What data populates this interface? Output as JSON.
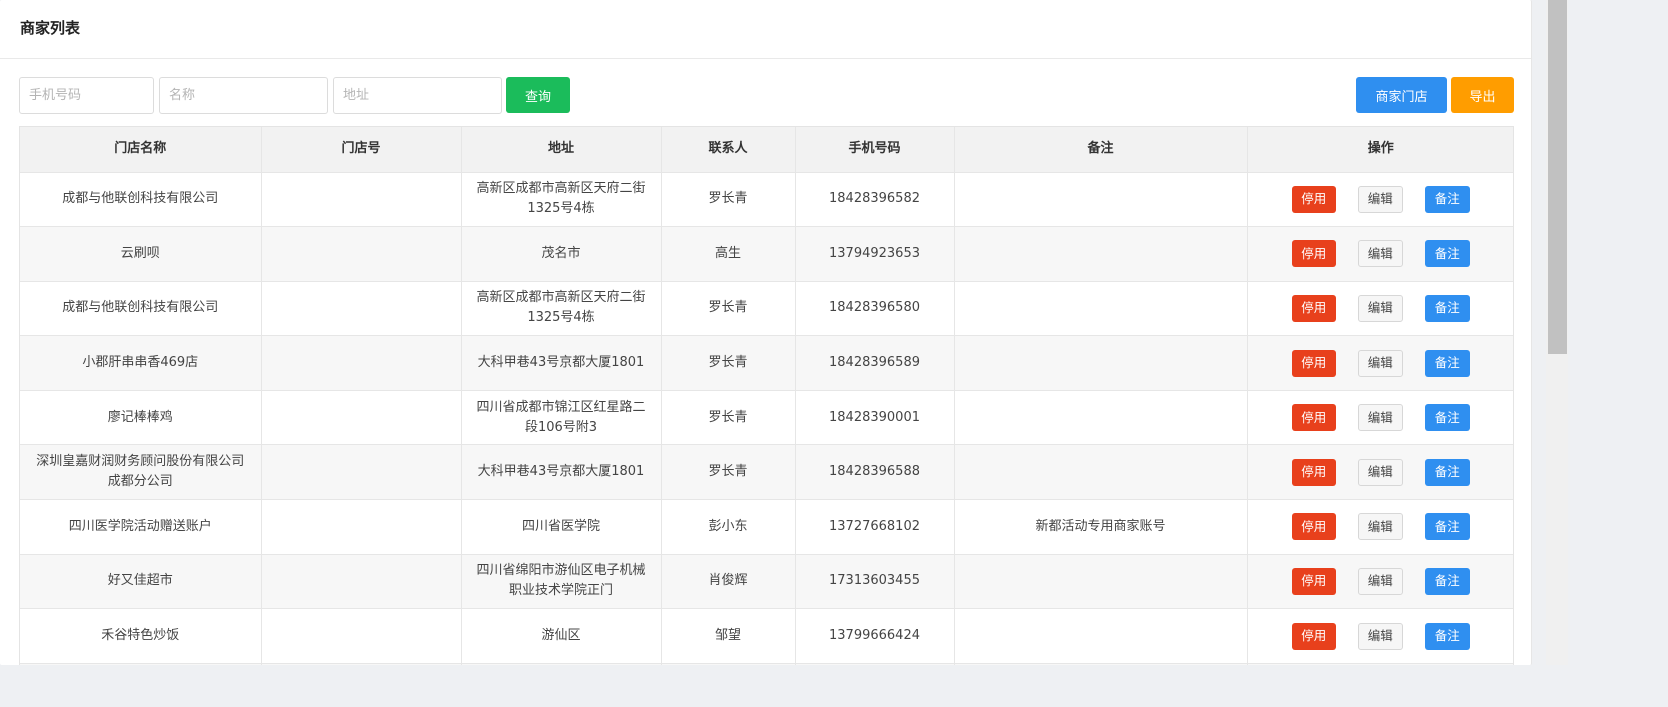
{
  "title": "商家列表",
  "search": {
    "phone_placeholder": "手机号码",
    "name_placeholder": "名称",
    "address_placeholder": "地址",
    "query_label": "查询"
  },
  "actions": {
    "stores_label": "商家门店",
    "export_label": "导出"
  },
  "table": {
    "headers": [
      "门店名称",
      "门店号",
      "地址",
      "联系人",
      "手机号码",
      "备注",
      "操作"
    ],
    "op_labels": {
      "disable": "停用",
      "edit": "编辑",
      "note": "备注"
    },
    "rows": [
      {
        "name": "成都与他联创科技有限公司",
        "store_no": "",
        "address": "高新区成都市高新区天府二街1325号4栋",
        "contact": "罗长青",
        "phone": "18428396582",
        "remark": ""
      },
      {
        "name": "云刷呗",
        "store_no": "",
        "address": "茂名市",
        "contact": "高生",
        "phone": "13794923653",
        "remark": ""
      },
      {
        "name": "成都与他联创科技有限公司",
        "store_no": "",
        "address": "高新区成都市高新区天府二街1325号4栋",
        "contact": "罗长青",
        "phone": "18428396580",
        "remark": ""
      },
      {
        "name": "小郡肝串串香469店",
        "store_no": "",
        "address": "大科甲巷43号京都大厦1801",
        "contact": "罗长青",
        "phone": "18428396589",
        "remark": ""
      },
      {
        "name": "廖记棒棒鸡",
        "store_no": "",
        "address": "四川省成都市锦江区红星路二段106号附3",
        "contact": "罗长青",
        "phone": "18428390001",
        "remark": ""
      },
      {
        "name": "深圳皇嘉财润财务顾问股份有限公司成都分公司",
        "store_no": "",
        "address": "大科甲巷43号京都大厦1801",
        "contact": "罗长青",
        "phone": "18428396588",
        "remark": ""
      },
      {
        "name": "四川医学院活动赠送账户",
        "store_no": "",
        "address": "四川省医学院",
        "contact": "彭小东",
        "phone": "13727668102",
        "remark": "新都活动专用商家账号"
      },
      {
        "name": "好又佳超市",
        "store_no": "",
        "address": "四川省绵阳市游仙区电子机械职业技术学院正门",
        "contact": "肖俊辉",
        "phone": "17313603455",
        "remark": ""
      },
      {
        "name": "禾谷特色炒饭",
        "store_no": "",
        "address": "游仙区",
        "contact": "邹望",
        "phone": "13799666424",
        "remark": ""
      },
      {
        "name": "",
        "store_no": "",
        "address": "",
        "contact": "",
        "phone": "",
        "remark": ""
      }
    ]
  },
  "colors": {
    "green": "#1bbc5b",
    "blue": "#2f8ff0",
    "orange": "#ff9d00",
    "red": "#e8401c"
  }
}
